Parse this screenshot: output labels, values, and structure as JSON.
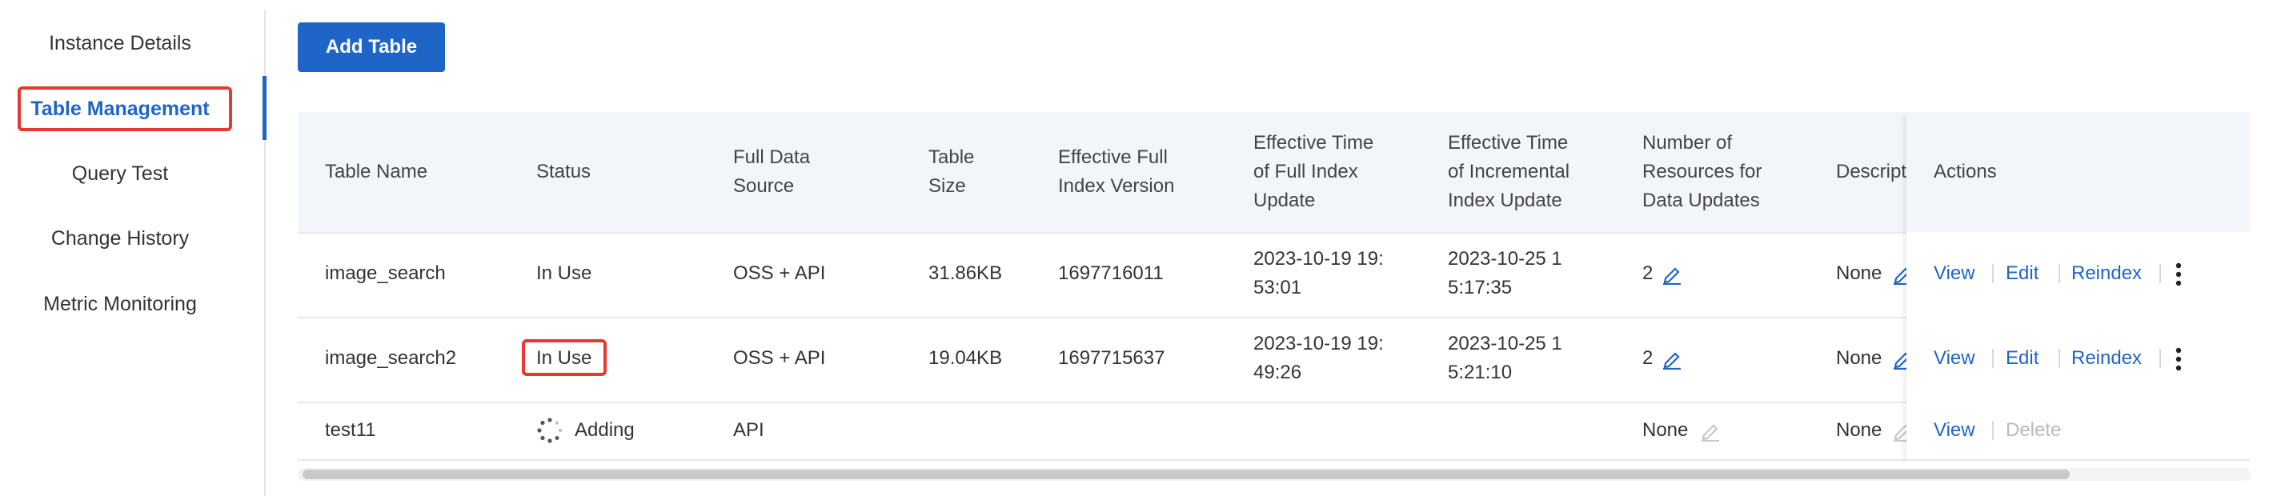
{
  "sidebar": {
    "items": [
      {
        "label": "Instance Details"
      },
      {
        "label": "Table Management"
      },
      {
        "label": "Query Test"
      },
      {
        "label": "Change History"
      },
      {
        "label": "Metric Monitoring"
      }
    ],
    "active": "Table Management"
  },
  "toolbar": {
    "add_table_label": "Add Table"
  },
  "table": {
    "headers": {
      "name": "Table Name",
      "status": "Status",
      "source": [
        "Full Data",
        "Source"
      ],
      "size": [
        "Table",
        "Size"
      ],
      "version": [
        "Effective Full",
        "Index Version"
      ],
      "full_time": [
        "Effective Time",
        "of Full Index",
        "Update"
      ],
      "inc_time": [
        "Effective Time",
        "of Incremental",
        "Index Update"
      ],
      "resources": [
        "Number of",
        "Resources for",
        "Data Updates"
      ],
      "description": "Descriptio",
      "actions": "Actions"
    },
    "rows": [
      {
        "name": "image_search",
        "status": "In Use",
        "source": "OSS + API",
        "size": "31.86KB",
        "version": "1697716011",
        "full_time": [
          "2023-10-19 19:",
          "53:01"
        ],
        "inc_time": [
          "2023-10-25 1",
          "5:17:35"
        ],
        "resources": "2",
        "description": "None",
        "actions": {
          "view": "View",
          "edit": "Edit",
          "reindex": "Reindex"
        }
      },
      {
        "name": "image_search2",
        "status": "In Use",
        "source": "OSS + API",
        "size": "19.04KB",
        "version": "1697715637",
        "full_time": [
          "2023-10-19 19:",
          "49:26"
        ],
        "inc_time": [
          "2023-10-25 1",
          "5:21:10"
        ],
        "resources": "2",
        "description": "None",
        "actions": {
          "view": "View",
          "edit": "Edit",
          "reindex": "Reindex"
        }
      },
      {
        "name": "test11",
        "status": "Adding",
        "source": "API",
        "size": "",
        "version": "",
        "full_time": [
          "",
          ""
        ],
        "inc_time": [
          "",
          ""
        ],
        "resources": "None",
        "description": "None",
        "actions": {
          "view": "View",
          "delete": "Delete"
        }
      }
    ]
  },
  "colors": {
    "accent": "#1f65c7",
    "highlight": "#e53a2f",
    "header_bg": "#f2f5fa"
  }
}
